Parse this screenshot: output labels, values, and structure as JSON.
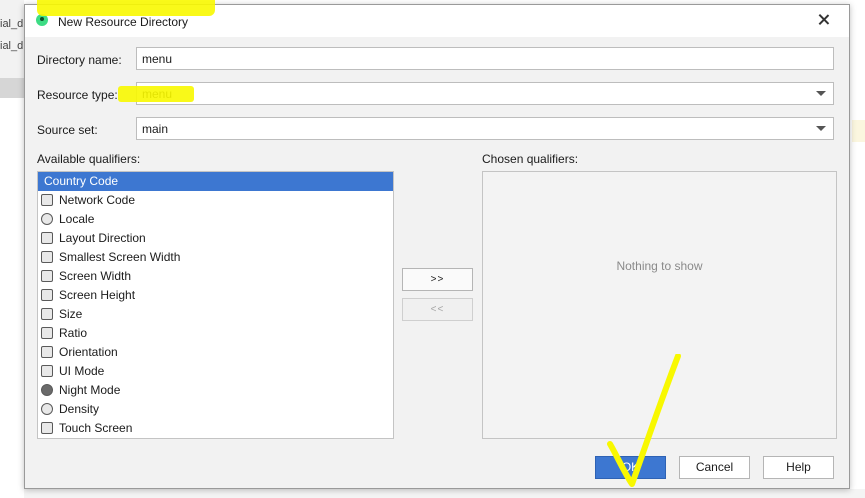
{
  "background": {
    "fragment_1": "ial_d",
    "fragment_2": "ial_d"
  },
  "dialog": {
    "title": "New Resource Directory",
    "directory_name_label": "Directory name:",
    "directory_name_value": "menu",
    "resource_type_label": "Resource type:",
    "resource_type_value": "menu",
    "source_set_label": "Source set:",
    "source_set_value": "main",
    "available_label": "Available qualifiers:",
    "chosen_label": "Chosen qualifiers:",
    "chosen_empty_text": "Nothing to show",
    "add_button": ">>",
    "remove_button": "<<",
    "ok_button": "OK",
    "cancel_button": "Cancel",
    "help_button": "Help"
  },
  "qualifiers": [
    {
      "label": "Country Code",
      "icon": "country-code-icon",
      "selected": true
    },
    {
      "label": "Network Code",
      "icon": "network-code-icon"
    },
    {
      "label": "Locale",
      "icon": "globe-icon"
    },
    {
      "label": "Layout Direction",
      "icon": "layout-direction-icon"
    },
    {
      "label": "Smallest Screen Width",
      "icon": "smallest-width-icon"
    },
    {
      "label": "Screen Width",
      "icon": "screen-width-icon"
    },
    {
      "label": "Screen Height",
      "icon": "screen-height-icon"
    },
    {
      "label": "Size",
      "icon": "size-icon"
    },
    {
      "label": "Ratio",
      "icon": "ratio-icon"
    },
    {
      "label": "Orientation",
      "icon": "orientation-icon"
    },
    {
      "label": "UI Mode",
      "icon": "ui-mode-icon"
    },
    {
      "label": "Night Mode",
      "icon": "night-mode-icon"
    },
    {
      "label": "Density",
      "icon": "density-icon"
    },
    {
      "label": "Touch Screen",
      "icon": "touch-screen-icon"
    }
  ],
  "colors": {
    "selection": "#3d77d1",
    "annotation_highlight": "#f8f800"
  }
}
